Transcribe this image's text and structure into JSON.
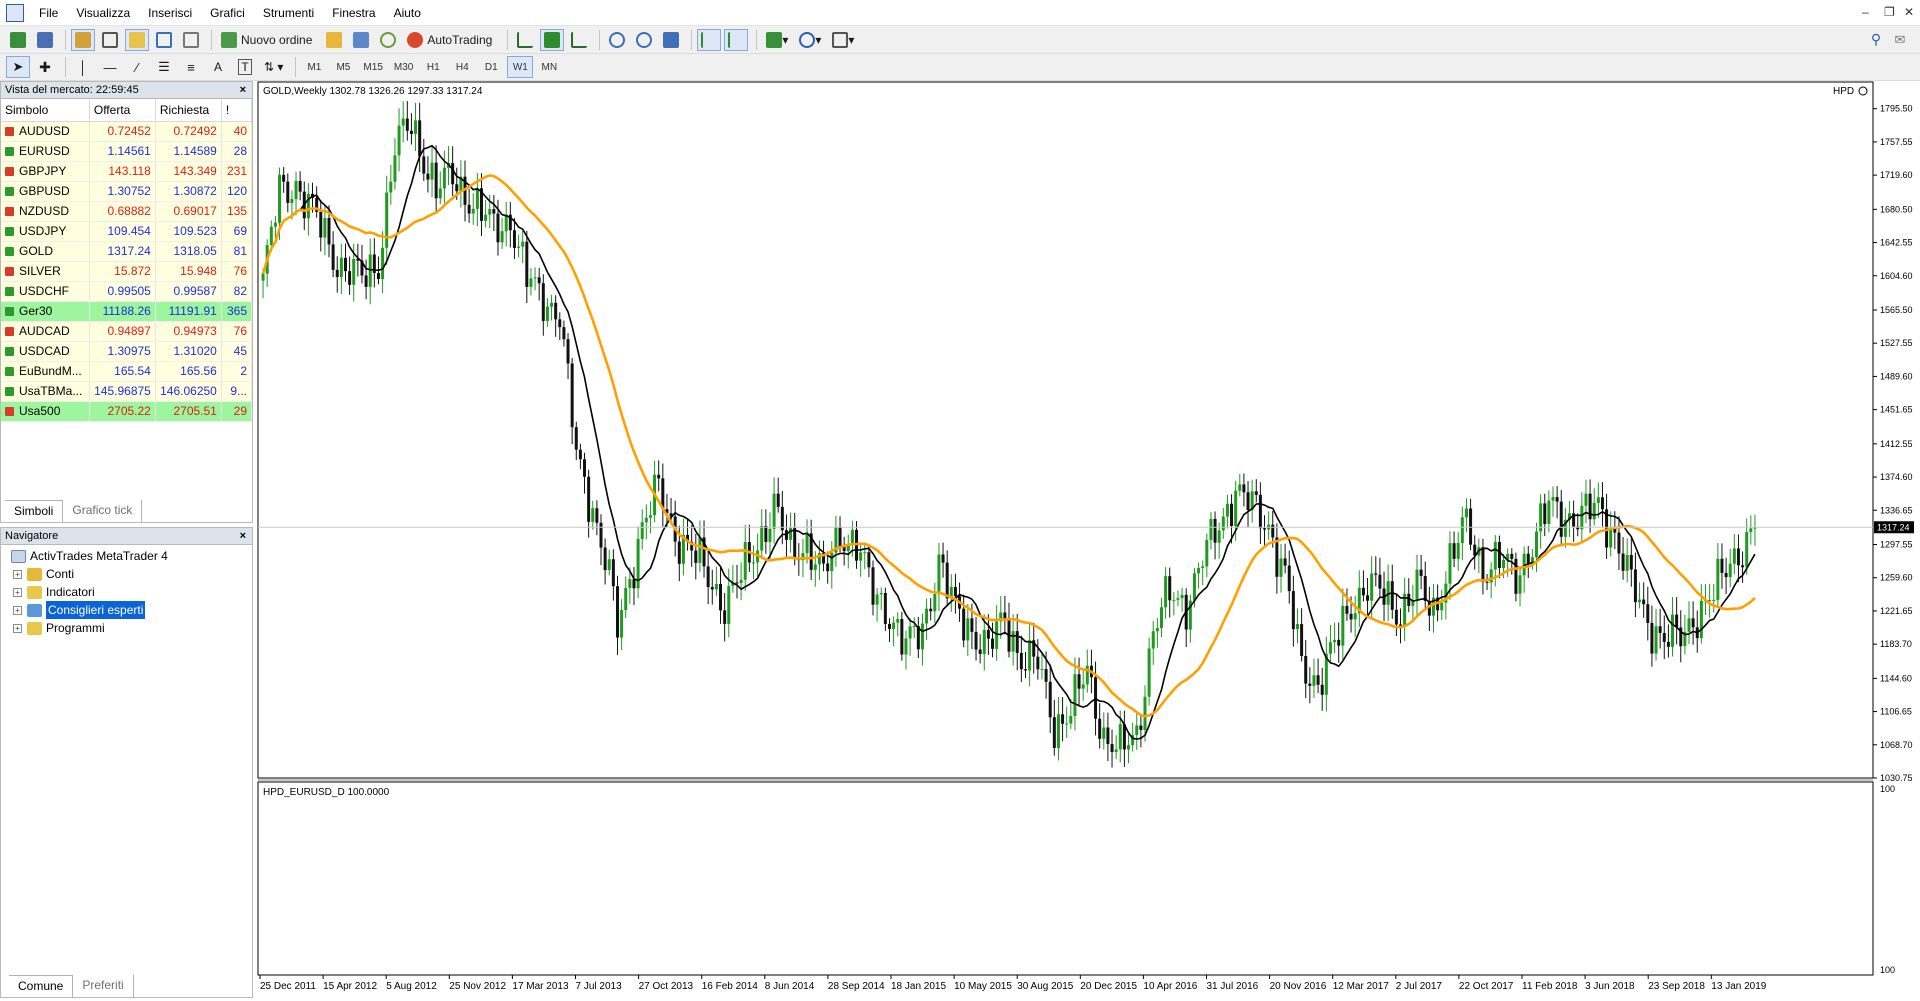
{
  "menu": [
    "File",
    "Visualizza",
    "Inserisci",
    "Grafici",
    "Strumenti",
    "Finestra",
    "Aiuto"
  ],
  "toolbar": {
    "new_order": "Nuovo ordine",
    "autotrading": "AutoTrading"
  },
  "timeframes": [
    "M1",
    "M5",
    "M15",
    "M30",
    "H1",
    "H4",
    "D1",
    "W1",
    "MN"
  ],
  "active_timeframe": "W1",
  "market_watch": {
    "title": "Vista del mercato: 22:59:45",
    "columns": [
      "Simbolo",
      "Offerta",
      "Richiesta",
      "!"
    ],
    "rows": [
      {
        "symbol": "AUDUSD",
        "bid": "0.72452",
        "ask": "0.72492",
        "spread": "40",
        "dir": "down",
        "bg": "#ffffe0"
      },
      {
        "symbol": "EURUSD",
        "bid": "1.14561",
        "ask": "1.14589",
        "spread": "28",
        "dir": "up",
        "bg": "#ffffe0"
      },
      {
        "symbol": "GBPJPY",
        "bid": "143.118",
        "ask": "143.349",
        "spread": "231",
        "dir": "down",
        "bg": "#ffffe0"
      },
      {
        "symbol": "GBPUSD",
        "bid": "1.30752",
        "ask": "1.30872",
        "spread": "120",
        "dir": "up",
        "bg": "#ffffe0"
      },
      {
        "symbol": "NZDUSD",
        "bid": "0.68882",
        "ask": "0.69017",
        "spread": "135",
        "dir": "down",
        "bg": "#ffffe0"
      },
      {
        "symbol": "USDJPY",
        "bid": "109.454",
        "ask": "109.523",
        "spread": "69",
        "dir": "up",
        "bg": "#ffffe0"
      },
      {
        "symbol": "GOLD",
        "bid": "1317.24",
        "ask": "1318.05",
        "spread": "81",
        "dir": "up",
        "bg": "#ffffe0"
      },
      {
        "symbol": "SILVER",
        "bid": "15.872",
        "ask": "15.948",
        "spread": "76",
        "dir": "down",
        "bg": "#ffffe0"
      },
      {
        "symbol": "USDCHF",
        "bid": "0.99505",
        "ask": "0.99587",
        "spread": "82",
        "dir": "up",
        "bg": "#ffffe0"
      },
      {
        "symbol": "Ger30",
        "bid": "11188.26",
        "ask": "11191.91",
        "spread": "365",
        "dir": "up",
        "bg": "#9df59d"
      },
      {
        "symbol": "AUDCAD",
        "bid": "0.94897",
        "ask": "0.94973",
        "spread": "76",
        "dir": "down",
        "bg": "#ffffe0"
      },
      {
        "symbol": "USDCAD",
        "bid": "1.30975",
        "ask": "1.31020",
        "spread": "45",
        "dir": "up",
        "bg": "#ffffe0"
      },
      {
        "symbol": "EuBundM...",
        "bid": "165.54",
        "ask": "165.56",
        "spread": "2",
        "dir": "up",
        "bg": "#ffffe0"
      },
      {
        "symbol": "UsaTBMa...",
        "bid": "145.96875",
        "ask": "146.06250",
        "spread": "9...",
        "dir": "up",
        "bg": "#ffffe0"
      },
      {
        "symbol": "Usa500",
        "bid": "2705.22",
        "ask": "2705.51",
        "spread": "29",
        "dir": "down",
        "bg": "#9df59d"
      }
    ],
    "tabs": [
      "Simboli",
      "Grafico tick"
    ]
  },
  "navigator": {
    "title": "Navigatore",
    "root": "ActivTrades MetaTrader 4",
    "items": [
      "Conti",
      "Indicatori",
      "Consiglieri esperti",
      "Programmi"
    ],
    "selected": "Consiglieri esperti",
    "tabs": [
      "Comune",
      "Preferiti"
    ]
  },
  "chart": {
    "header": "GOLD,Weekly  1302.78 1326.26 1297.33 1317.24",
    "indicator_label": "HPD",
    "subwindow_label": "HPD_EURUSD_D 100.0000",
    "price_label": "1317.24",
    "colors": {
      "bull": "#1e9a1e",
      "bear": "#111111",
      "ma_fast": "#000000",
      "ma_slow": "#ffa000"
    }
  },
  "chart_data": {
    "type": "candlestick",
    "symbol": "GOLD",
    "timeframe": "Weekly",
    "y_ticks": [
      "1795.50",
      "1757.55",
      "1719.60",
      "1680.50",
      "1642.55",
      "1604.60",
      "1565.50",
      "1527.55",
      "1489.60",
      "1451.65",
      "1412.55",
      "1374.60",
      "1336.65",
      "1297.55",
      "1259.60",
      "1221.65",
      "1183.70",
      "1144.60",
      "1106.65",
      "1068.70",
      "1030.75"
    ],
    "ylim": [
      1030.75,
      1818
    ],
    "x_ticks": [
      "25 Dec 2011",
      "15 Apr 2012",
      "5 Aug 2012",
      "25 Nov 2012",
      "17 Mar 2013",
      "7 Jul 2013",
      "27 Oct 2013",
      "16 Feb 2014",
      "8 Jun 2014",
      "28 Sep 2014",
      "18 Jan 2015",
      "10 May 2015",
      "30 Aug 2015",
      "20 Dec 2015",
      "10 Apr 2016",
      "31 Jul 2016",
      "20 Nov 2016",
      "12 Mar 2017",
      "2 Jul 2017",
      "22 Oct 2017",
      "11 Feb 2018",
      "3 Jun 2018",
      "23 Sep 2018",
      "13 Jan 2019"
    ],
    "sub_ticks": [
      "100",
      "100"
    ],
    "close_anchors": [
      [
        0,
        1600
      ],
      [
        4,
        1700
      ],
      [
        8,
        1710
      ],
      [
        14,
        1660
      ],
      [
        18,
        1620
      ],
      [
        24,
        1600
      ],
      [
        28,
        1620
      ],
      [
        32,
        1750
      ],
      [
        36,
        1780
      ],
      [
        42,
        1700
      ],
      [
        46,
        1720
      ],
      [
        52,
        1680
      ],
      [
        56,
        1660
      ],
      [
        60,
        1670
      ],
      [
        64,
        1600
      ],
      [
        68,
        1580
      ],
      [
        72,
        1560
      ],
      [
        76,
        1400
      ],
      [
        80,
        1340
      ],
      [
        84,
        1260
      ],
      [
        86,
        1200
      ],
      [
        88,
        1240
      ],
      [
        92,
        1320
      ],
      [
        96,
        1360
      ],
      [
        100,
        1310
      ],
      [
        104,
        1290
      ],
      [
        108,
        1260
      ],
      [
        112,
        1230
      ],
      [
        116,
        1260
      ],
      [
        120,
        1300
      ],
      [
        124,
        1340
      ],
      [
        128,
        1290
      ],
      [
        132,
        1300
      ],
      [
        136,
        1260
      ],
      [
        140,
        1310
      ],
      [
        144,
        1300
      ],
      [
        148,
        1240
      ],
      [
        152,
        1220
      ],
      [
        156,
        1180
      ],
      [
        160,
        1200
      ],
      [
        164,
        1280
      ],
      [
        168,
        1220
      ],
      [
        172,
        1200
      ],
      [
        176,
        1180
      ],
      [
        180,
        1210
      ],
      [
        184,
        1170
      ],
      [
        188,
        1160
      ],
      [
        192,
        1090
      ],
      [
        196,
        1110
      ],
      [
        200,
        1150
      ],
      [
        204,
        1080
      ],
      [
        208,
        1060
      ],
      [
        212,
        1080
      ],
      [
        216,
        1200
      ],
      [
        220,
        1240
      ],
      [
        224,
        1230
      ],
      [
        228,
        1280
      ],
      [
        232,
        1320
      ],
      [
        236,
        1360
      ],
      [
        240,
        1340
      ],
      [
        244,
        1320
      ],
      [
        248,
        1260
      ],
      [
        252,
        1160
      ],
      [
        256,
        1140
      ],
      [
        260,
        1180
      ],
      [
        264,
        1230
      ],
      [
        268,
        1250
      ],
      [
        272,
        1240
      ],
      [
        276,
        1220
      ],
      [
        280,
        1250
      ],
      [
        284,
        1220
      ],
      [
        288,
        1280
      ],
      [
        292,
        1320
      ],
      [
        296,
        1270
      ],
      [
        300,
        1280
      ],
      [
        304,
        1260
      ],
      [
        308,
        1300
      ],
      [
        312,
        1340
      ],
      [
        316,
        1330
      ],
      [
        320,
        1330
      ],
      [
        324,
        1340
      ],
      [
        328,
        1310
      ],
      [
        332,
        1250
      ],
      [
        336,
        1210
      ],
      [
        340,
        1190
      ],
      [
        344,
        1190
      ],
      [
        348,
        1220
      ],
      [
        352,
        1240
      ],
      [
        356,
        1280
      ],
      [
        360,
        1300
      ],
      [
        362,
        1317
      ]
    ]
  }
}
